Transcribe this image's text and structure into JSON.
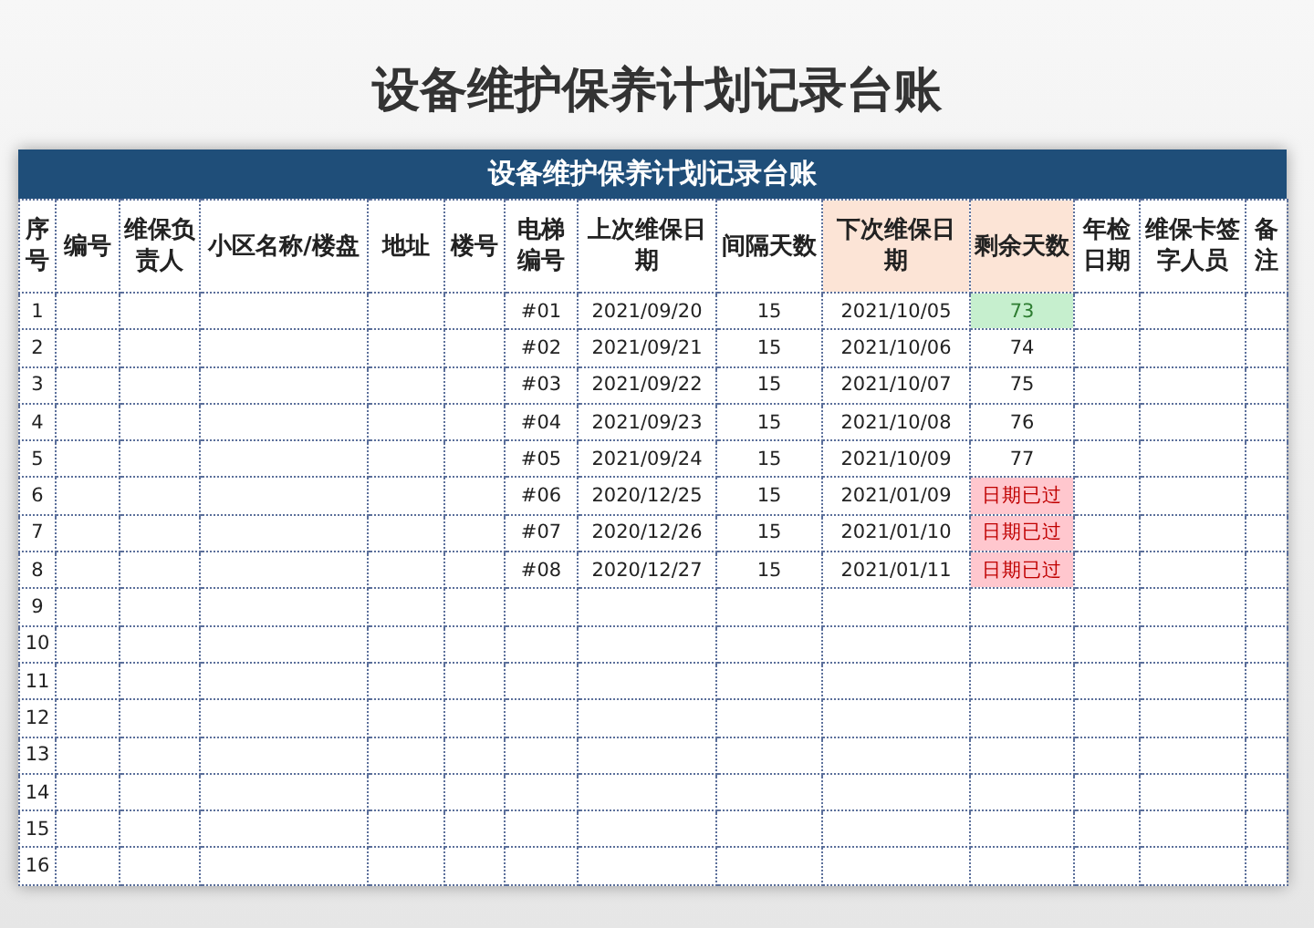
{
  "page_title": "设备维护保养计划记录台账",
  "table": {
    "banner": "设备维护保养计划记录台账",
    "columns": [
      {
        "label": "序号",
        "highlighted": false
      },
      {
        "label": "编号",
        "highlighted": false
      },
      {
        "label": "维保负责人",
        "highlighted": false
      },
      {
        "label": "小区名称/楼盘",
        "highlighted": false
      },
      {
        "label": "地址",
        "highlighted": false
      },
      {
        "label": "楼号",
        "highlighted": false
      },
      {
        "label": "电梯编号",
        "highlighted": false
      },
      {
        "label": "上次维保日期",
        "highlighted": false
      },
      {
        "label": "间隔天数",
        "highlighted": false
      },
      {
        "label": "下次维保日期",
        "highlighted": true
      },
      {
        "label": "剩余天数",
        "highlighted": true
      },
      {
        "label": "年检日期",
        "highlighted": false
      },
      {
        "label": "维保卡签字人员",
        "highlighted": false
      },
      {
        "label": "备注",
        "highlighted": false
      }
    ],
    "rows": [
      {
        "no": "1",
        "elevator": "#01",
        "last_date": "2021/09/20",
        "interval": "15",
        "next_date": "2021/10/05",
        "remaining": "73",
        "kind": "ok"
      },
      {
        "no": "2",
        "elevator": "#02",
        "last_date": "2021/09/21",
        "interval": "15",
        "next_date": "2021/10/06",
        "remaining": "74",
        "kind": "normal"
      },
      {
        "no": "3",
        "elevator": "#03",
        "last_date": "2021/09/22",
        "interval": "15",
        "next_date": "2021/10/07",
        "remaining": "75",
        "kind": "normal"
      },
      {
        "no": "4",
        "elevator": "#04",
        "last_date": "2021/09/23",
        "interval": "15",
        "next_date": "2021/10/08",
        "remaining": "76",
        "kind": "normal"
      },
      {
        "no": "5",
        "elevator": "#05",
        "last_date": "2021/09/24",
        "interval": "15",
        "next_date": "2021/10/09",
        "remaining": "77",
        "kind": "normal"
      },
      {
        "no": "6",
        "elevator": "#06",
        "last_date": "2020/12/25",
        "interval": "15",
        "next_date": "2021/01/09",
        "remaining": "日期已过",
        "kind": "overdue"
      },
      {
        "no": "7",
        "elevator": "#07",
        "last_date": "2020/12/26",
        "interval": "15",
        "next_date": "2021/01/10",
        "remaining": "日期已过",
        "kind": "overdue"
      },
      {
        "no": "8",
        "elevator": "#08",
        "last_date": "2020/12/27",
        "interval": "15",
        "next_date": "2021/01/11",
        "remaining": "日期已过",
        "kind": "overdue"
      },
      {
        "no": "9"
      },
      {
        "no": "10"
      },
      {
        "no": "11"
      },
      {
        "no": "12"
      },
      {
        "no": "13"
      },
      {
        "no": "14"
      },
      {
        "no": "15"
      },
      {
        "no": "16"
      }
    ]
  }
}
